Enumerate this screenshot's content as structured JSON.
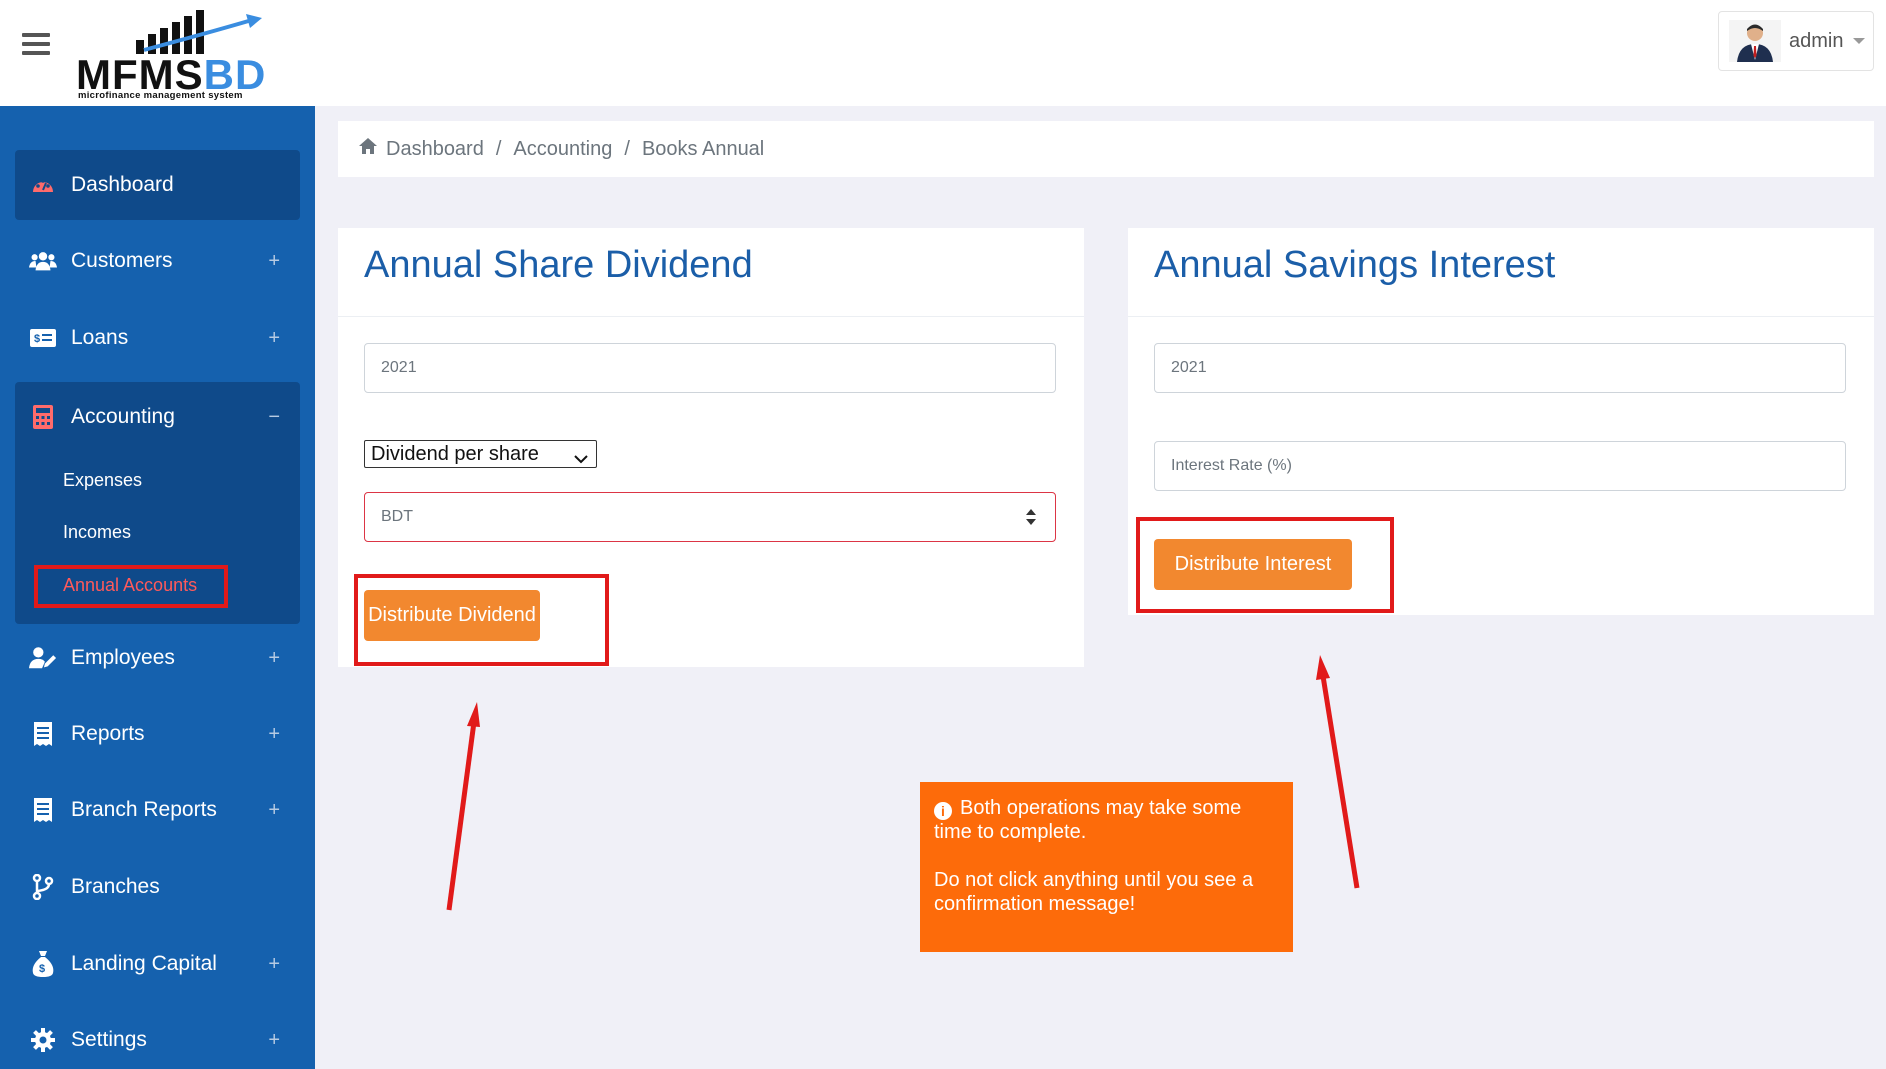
{
  "brand": {
    "logo_dark": "MFMS",
    "logo_blue": "BD",
    "tagline": "microfinance management system"
  },
  "user": {
    "name": "admin"
  },
  "sidebar": {
    "items": [
      {
        "label": "Dashboard",
        "icon": "palette-icon"
      },
      {
        "label": "Customers",
        "icon": "users-icon"
      },
      {
        "label": "Loans",
        "icon": "money-bill-icon"
      },
      {
        "label": "Accounting",
        "icon": "calculator-icon"
      },
      {
        "label": "Employees",
        "icon": "user-edit-icon"
      },
      {
        "label": "Reports",
        "icon": "receipt-icon"
      },
      {
        "label": "Branch Reports",
        "icon": "receipt-icon"
      },
      {
        "label": "Branches",
        "icon": "code-branch-icon"
      },
      {
        "label": "Landing Capital",
        "icon": "money-bag-icon"
      },
      {
        "label": "Settings",
        "icon": "gear-icon"
      }
    ],
    "accounting_sub": [
      "Expenses",
      "Incomes",
      "Annual Accounts"
    ],
    "expand_symbol": "+",
    "collapse_symbol": "−"
  },
  "breadcrumb": {
    "items": [
      "Dashboard",
      "Accounting",
      "Books Annual"
    ],
    "separator": "/"
  },
  "dividend_card": {
    "title": "Annual Share Dividend",
    "year_value": "2021",
    "select_value": "Dividend per share",
    "amount_placeholder": "BDT",
    "button_label": "Distribute Dividend"
  },
  "interest_card": {
    "title": "Annual Savings Interest",
    "year_value": "2021",
    "rate_placeholder": "Interest Rate (%)",
    "button_label": "Distribute Interest"
  },
  "notice": {
    "line1": "Both operations may take some time to complete.",
    "line2": "Do not click anything until you see a confirmation message!"
  },
  "colors": {
    "sidebar": "#1561ae",
    "sidebar_active": "#0f4a8a",
    "accent_button": "#f2882f",
    "notice": "#fd6b0a",
    "title_blue": "#1b5ea8",
    "highlight_red": "#e11a1a"
  }
}
